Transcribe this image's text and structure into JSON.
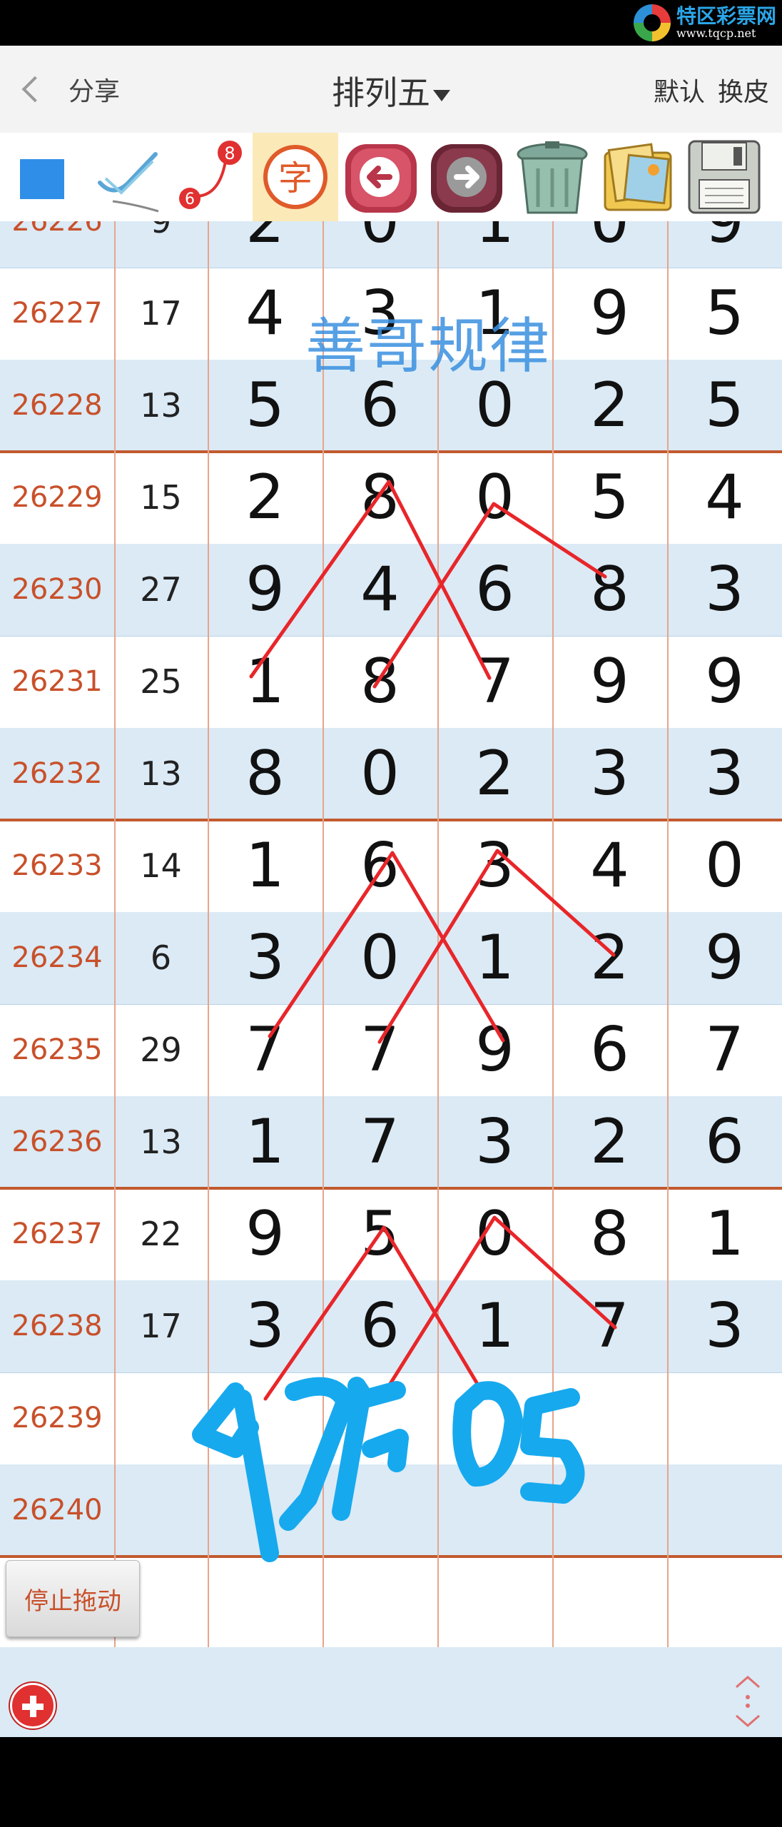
{
  "status_bar": {
    "brand_name": "特区彩票网",
    "brand_url": "www.tqcp.net"
  },
  "header": {
    "back_label": "分享",
    "title": "排列五",
    "actions": [
      "默认",
      "换皮"
    ]
  },
  "toolbar": {
    "tools": [
      {
        "name": "square-color-tool",
        "icon": "blue-square"
      },
      {
        "name": "pen-tool",
        "icon": "pen-check"
      },
      {
        "name": "connect-line-tool",
        "icon": "connect-6-8",
        "label_a": "8",
        "label_b": "6"
      },
      {
        "name": "text-tool",
        "icon": "char",
        "label": "字"
      },
      {
        "name": "undo-tool",
        "icon": "arrow-left"
      },
      {
        "name": "redo-tool",
        "icon": "arrow-right"
      },
      {
        "name": "trash-tool",
        "icon": "trash"
      },
      {
        "name": "gallery-tool",
        "icon": "photos"
      },
      {
        "name": "save-tool",
        "icon": "floppy"
      }
    ]
  },
  "table": {
    "partial_top_row": {
      "issue": "26226",
      "sum": "9",
      "digits": [
        "2",
        "0",
        "1",
        "0",
        "9"
      ]
    },
    "rows": [
      {
        "issue": "26227",
        "sum": "17",
        "digits": [
          "4",
          "3",
          "1",
          "9",
          "5"
        ]
      },
      {
        "issue": "26228",
        "sum": "13",
        "digits": [
          "5",
          "6",
          "0",
          "2",
          "5"
        ]
      },
      {
        "issue": "26229",
        "sum": "15",
        "digits": [
          "2",
          "8",
          "0",
          "5",
          "4"
        ]
      },
      {
        "issue": "26230",
        "sum": "27",
        "digits": [
          "9",
          "4",
          "6",
          "8",
          "3"
        ]
      },
      {
        "issue": "26231",
        "sum": "25",
        "digits": [
          "1",
          "8",
          "7",
          "9",
          "9"
        ]
      },
      {
        "issue": "26232",
        "sum": "13",
        "digits": [
          "8",
          "0",
          "2",
          "3",
          "3"
        ]
      },
      {
        "issue": "26233",
        "sum": "14",
        "digits": [
          "1",
          "6",
          "3",
          "4",
          "0"
        ]
      },
      {
        "issue": "26234",
        "sum": "6",
        "digits": [
          "3",
          "0",
          "1",
          "2",
          "9"
        ]
      },
      {
        "issue": "26235",
        "sum": "29",
        "digits": [
          "7",
          "7",
          "9",
          "6",
          "7"
        ]
      },
      {
        "issue": "26236",
        "sum": "13",
        "digits": [
          "1",
          "7",
          "3",
          "2",
          "6"
        ]
      },
      {
        "issue": "26237",
        "sum": "22",
        "digits": [
          "9",
          "5",
          "0",
          "8",
          "1"
        ]
      },
      {
        "issue": "26238",
        "sum": "17",
        "digits": [
          "3",
          "6",
          "1",
          "7",
          "3"
        ]
      },
      {
        "issue": "26239",
        "sum": "",
        "digits": [
          "",
          "",
          "",
          "",
          ""
        ]
      },
      {
        "issue": "26240",
        "sum": "",
        "digits": [
          "",
          "",
          "",
          "",
          ""
        ]
      }
    ]
  },
  "annotations": {
    "watermark_text": "善哥规律",
    "handwritten": "49705",
    "line_color": "#e8262a",
    "handwriting_color": "#17a9ee"
  },
  "stop_drag_label": "停止拖动",
  "bottom": {
    "add_icon": "plus-circle-icon",
    "resize_icon": "resize-vertical-icon"
  }
}
